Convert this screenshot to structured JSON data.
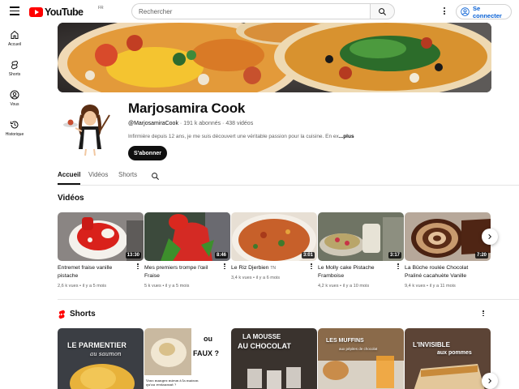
{
  "topbar": {
    "logo_text": "YouTube",
    "country": "FR",
    "search_placeholder": "Rechercher",
    "signin_label": "Se connecter"
  },
  "sidebar": {
    "items": [
      {
        "label": "Accueil",
        "icon": "home-icon"
      },
      {
        "label": "Shorts",
        "icon": "shorts-icon"
      },
      {
        "label": "Vous",
        "icon": "user-icon"
      },
      {
        "label": "Historique",
        "icon": "history-icon"
      }
    ]
  },
  "channel": {
    "name": "Marjosamira Cook",
    "handle": "@MarjosamiraCook",
    "subscribers": " · 191 k abonnés · 438 vidéos",
    "description": "Infirmière depuis 12 ans, je me suis découvert une véritable passion pour la cuisine. En ex",
    "more": "...plus",
    "subscribe_label": "S'abonner"
  },
  "tabs": [
    "Accueil",
    "Vidéos",
    "Shorts"
  ],
  "videos_section": {
    "title": "Vidéos",
    "items": [
      {
        "title": "Entremet fraise vanille pistache",
        "tag": "",
        "duration": "13:30",
        "meta": "2,6 k vues • il y a 5 mois"
      },
      {
        "title": "Mes premiers trompe l'œil Fraise",
        "tag": "",
        "duration": "8:46",
        "meta": "5 k vues • il y a 5 mois"
      },
      {
        "title": "Le Riz Djerbien",
        "tag": "TN",
        "duration": "3:01",
        "meta": "3,4 k vues • il y a 6 mois"
      },
      {
        "title": "Le Molly cake Pistache Framboise",
        "tag": "",
        "duration": "3:17",
        "meta": "4,2 k vues • il y a 10 mois"
      },
      {
        "title": "La Bûche roulée Chocolat Praliné cacahuète Vanille",
        "tag": "",
        "duration": "7:20",
        "meta": "9,4 k vues • il y a 11 mois"
      }
    ]
  },
  "shorts_section": {
    "title": "Shorts",
    "items": [
      {
        "line1": "LE PARMENTIER",
        "line2": "au saumon"
      },
      {
        "line1": "ou",
        "line2": "FAUX ?",
        "caption": "Vous mangez mieux à la maison qu'au restaurant ?"
      },
      {
        "line1": "LA MOUSSE",
        "line2": "AU CHOCOLAT"
      },
      {
        "line1": "LES MUFFINS",
        "line2": "aux pépites de chocolat"
      },
      {
        "line1": "L'INVISIBLE",
        "line2": "aux pommes"
      }
    ]
  },
  "colors": {
    "brand": "#ff0000",
    "link": "#065fd4",
    "dark": "#0f0f0f"
  }
}
